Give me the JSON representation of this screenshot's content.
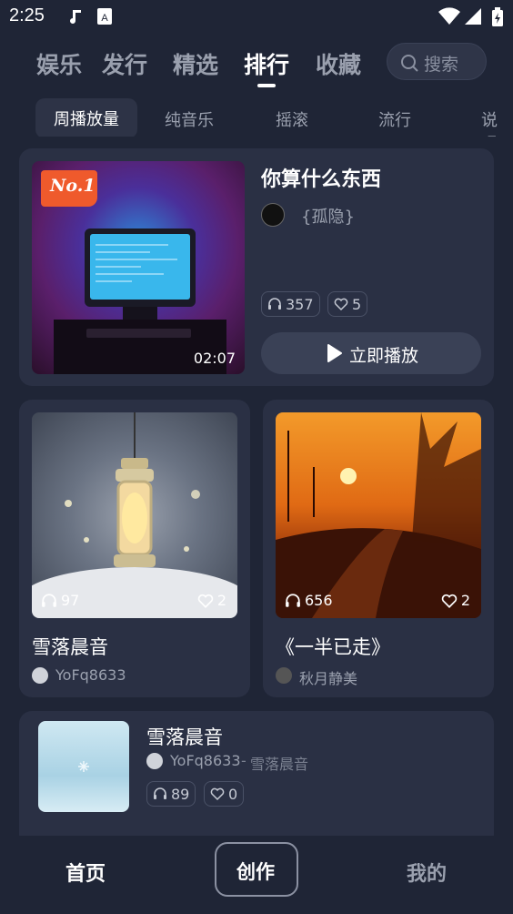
{
  "status": {
    "time": "2:25"
  },
  "tabs": [
    {
      "label": "娱乐",
      "active": false
    },
    {
      "label": "发行",
      "active": false
    },
    {
      "label": "精选",
      "active": false
    },
    {
      "label": "排行",
      "active": true
    },
    {
      "label": "收藏",
      "active": false
    }
  ],
  "search": {
    "placeholder": "搜索"
  },
  "subtabs": [
    "周播放量",
    "纯音乐",
    "摇滚",
    "流行",
    "说唱"
  ],
  "featured": {
    "badge": "No.1",
    "duration": "02:07",
    "title": "你算什么东西",
    "artist": "{孤隐}",
    "plays": "357",
    "likes": "5",
    "play_label": "立即播放"
  },
  "grid": [
    {
      "title": "雪落晨音",
      "artist": "YoFq8633",
      "plays": "97",
      "likes": "2"
    },
    {
      "title": "《一半已走》",
      "artist": "秋月静美",
      "plays": "656",
      "likes": "2"
    }
  ],
  "list_item": {
    "title": "雪落晨音",
    "artist": "YoFq8633",
    "album": "雪落晨音",
    "plays": "89",
    "likes": "0"
  },
  "bottom_nav": {
    "home": "首页",
    "create": "创作",
    "mine": "我的"
  }
}
